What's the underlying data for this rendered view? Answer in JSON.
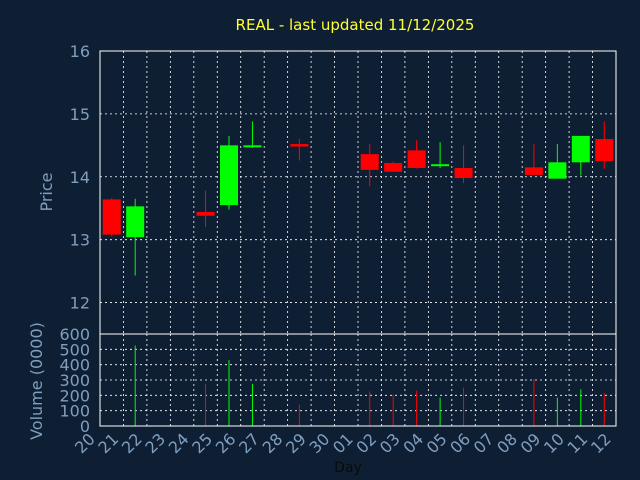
{
  "chart_data": {
    "type": "candlestick",
    "title": "REAL - last updated 11/12/2025",
    "price_ylabel": "Price",
    "volume_ylabel": "Volume (0000)",
    "xlabel": "Day",
    "price_ylim": [
      11.5,
      16
    ],
    "price_yticks": [
      "12",
      "13",
      "14",
      "15",
      "16"
    ],
    "volume_ylim": [
      0,
      600
    ],
    "volume_yticks": [
      "0",
      "100",
      "200",
      "300",
      "400",
      "500",
      "600"
    ],
    "x_ticks": [
      "20",
      "21",
      "22",
      "23",
      "24",
      "25",
      "26",
      "27",
      "28",
      "29",
      "30",
      "01",
      "02",
      "03",
      "04",
      "05",
      "06",
      "07",
      "08",
      "09",
      "10",
      "11",
      "12"
    ],
    "colors": {
      "up": "#00ff00",
      "down": "#ff0000",
      "background": "#0f1f33",
      "title": "#ffff33",
      "axis_text": "#7f9fbf"
    },
    "candles": [
      {
        "day": "20",
        "open": 13.64,
        "high": 13.66,
        "low": 13.05,
        "close": 13.08,
        "volume": 0
      },
      {
        "day": "21",
        "open": 13.04,
        "high": 13.65,
        "low": 12.43,
        "close": 13.53,
        "volume": 525
      },
      {
        "day": "24",
        "open": 13.44,
        "high": 13.78,
        "low": 13.2,
        "close": 13.38,
        "volume": 275
      },
      {
        "day": "25",
        "open": 13.55,
        "high": 14.65,
        "low": 13.48,
        "close": 14.5,
        "volume": 430
      },
      {
        "day": "26",
        "open": 14.48,
        "high": 14.88,
        "low": 14.46,
        "close": 14.5,
        "volume": 275
      },
      {
        "day": "28",
        "open": 14.52,
        "high": 14.6,
        "low": 14.26,
        "close": 14.48,
        "volume": 140
      },
      {
        "day": "01",
        "open": 14.36,
        "high": 14.52,
        "low": 13.85,
        "close": 14.11,
        "volume": 225
      },
      {
        "day": "02",
        "open": 14.22,
        "high": 14.24,
        "low": 14.08,
        "close": 14.08,
        "volume": 205
      },
      {
        "day": "03",
        "open": 14.42,
        "high": 14.58,
        "low": 14.13,
        "close": 14.14,
        "volume": 230
      },
      {
        "day": "04",
        "open": 14.17,
        "high": 14.55,
        "low": 14.14,
        "close": 14.2,
        "volume": 185
      },
      {
        "day": "05",
        "open": 14.14,
        "high": 14.5,
        "low": 13.9,
        "close": 13.98,
        "volume": 250
      },
      {
        "day": "08",
        "open": 14.15,
        "high": 14.52,
        "low": 14.03,
        "close": 14.03,
        "volume": 305
      },
      {
        "day": "09",
        "open": 13.97,
        "high": 14.52,
        "low": 13.97,
        "close": 14.23,
        "volume": 185
      },
      {
        "day": "10",
        "open": 14.23,
        "high": 14.65,
        "low": 14.02,
        "close": 14.65,
        "volume": 240
      },
      {
        "day": "11",
        "open": 14.6,
        "high": 14.88,
        "low": 14.13,
        "close": 14.25,
        "volume": 215
      }
    ]
  }
}
